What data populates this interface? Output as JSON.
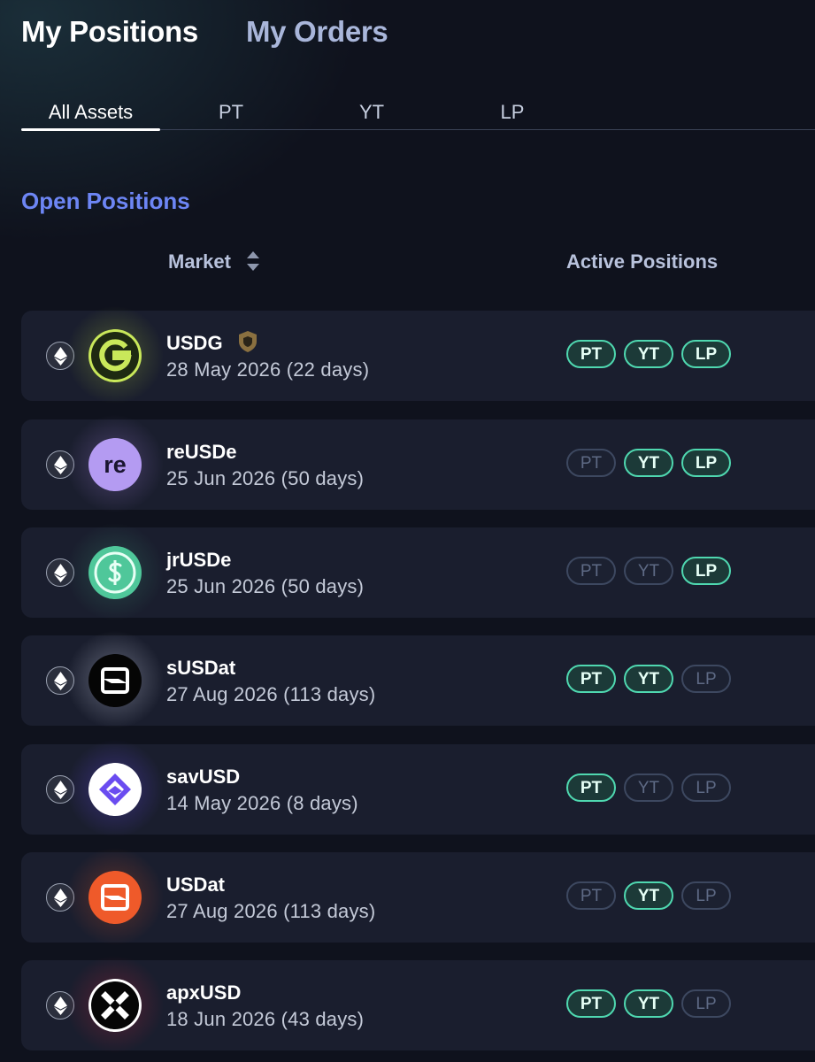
{
  "header": {
    "tabs": [
      {
        "label": "My Positions",
        "active": true
      },
      {
        "label": "My Orders",
        "active": false
      }
    ]
  },
  "asset_tabs": [
    {
      "label": "All Assets",
      "active": true
    },
    {
      "label": "PT",
      "active": false
    },
    {
      "label": "YT",
      "active": false
    },
    {
      "label": "LP",
      "active": false
    }
  ],
  "section": {
    "title": "Open Positions"
  },
  "table": {
    "columns": {
      "market": "Market",
      "active_positions": "Active Positions"
    }
  },
  "positions": [
    {
      "name": "USDG",
      "date": "28 May 2026 (22 days)",
      "logo": "usdg-logo",
      "verified": true,
      "pills": [
        {
          "label": "PT",
          "active": true
        },
        {
          "label": "YT",
          "active": true
        },
        {
          "label": "LP",
          "active": true
        }
      ]
    },
    {
      "name": "reUSDe",
      "date": "25 Jun 2026 (50 days)",
      "logo": "reusde-logo",
      "logo_text": "re",
      "pills": [
        {
          "label": "PT",
          "active": false
        },
        {
          "label": "YT",
          "active": true
        },
        {
          "label": "LP",
          "active": true
        }
      ]
    },
    {
      "name": "jrUSDe",
      "date": "25 Jun 2026 (50 days)",
      "logo": "jrusde-logo",
      "pills": [
        {
          "label": "PT",
          "active": false
        },
        {
          "label": "YT",
          "active": false
        },
        {
          "label": "LP",
          "active": true
        }
      ]
    },
    {
      "name": "sUSDat",
      "date": "27 Aug 2026 (113 days)",
      "logo": "susdat-logo",
      "pills": [
        {
          "label": "PT",
          "active": true
        },
        {
          "label": "YT",
          "active": true
        },
        {
          "label": "LP",
          "active": false
        }
      ]
    },
    {
      "name": "savUSD",
      "date": "14 May 2026 (8 days)",
      "logo": "savusd-logo",
      "pills": [
        {
          "label": "PT",
          "active": true
        },
        {
          "label": "YT",
          "active": false
        },
        {
          "label": "LP",
          "active": false
        }
      ]
    },
    {
      "name": "USDat",
      "date": "27 Aug 2026 (113 days)",
      "logo": "usdat-logo",
      "pills": [
        {
          "label": "PT",
          "active": false
        },
        {
          "label": "YT",
          "active": true
        },
        {
          "label": "LP",
          "active": false
        }
      ]
    },
    {
      "name": "apxUSD",
      "date": "18 Jun 2026 (43 days)",
      "logo": "apxusd-logo",
      "pills": [
        {
          "label": "PT",
          "active": true
        },
        {
          "label": "YT",
          "active": true
        },
        {
          "label": "LP",
          "active": false
        }
      ]
    }
  ],
  "colors": {
    "accent_green": "#4fd8b0",
    "section_title": "#6d86f5",
    "row_background": "#1a1e2e"
  }
}
